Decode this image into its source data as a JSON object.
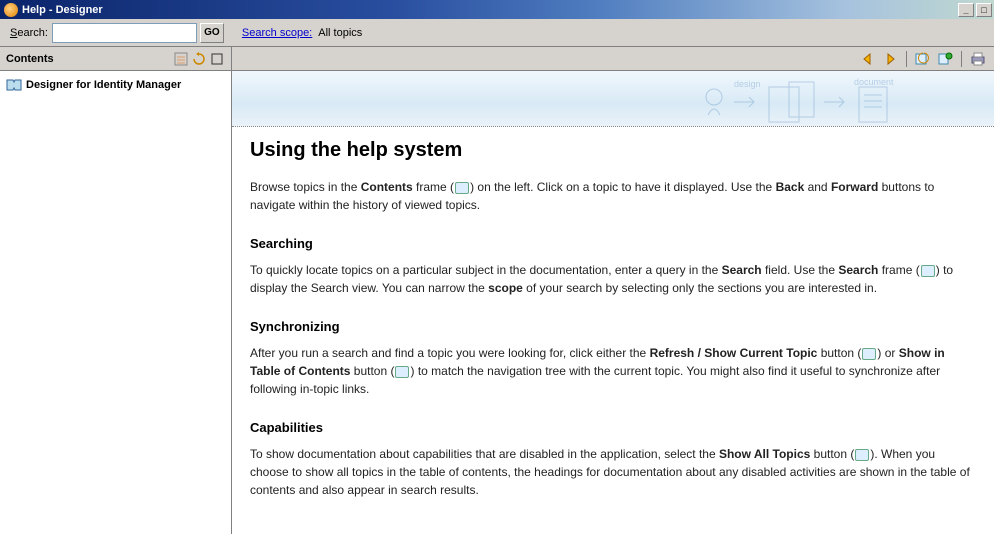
{
  "window": {
    "title": "Help - Designer",
    "min": "_",
    "max": "□"
  },
  "searchbar": {
    "label_underline": "S",
    "label_rest": "earch:",
    "go": "GO",
    "scope_label": "Search scope:",
    "scope_value": "All topics",
    "placeholder": ""
  },
  "contents": {
    "title": "Contents",
    "root": "Designer for Identity Manager"
  },
  "doc": {
    "title": "Using the help system",
    "p1a": "Browse topics in the ",
    "p1b": "Contents",
    "p1c": " frame (",
    "p1d": ") on the left. Click on a topic to have it displayed. Use the ",
    "p1e": "Back",
    "p1f": " and ",
    "p1g": "Forward",
    "p1h": " buttons to navigate within the history of viewed topics.",
    "h_search": "Searching",
    "p2a": "To quickly locate topics on a particular subject in the documentation, enter a query in the ",
    "p2b": "Search",
    "p2c": " field. Use the ",
    "p2d": "Search",
    "p2e": " frame (",
    "p2f": ") to display the Search view. You can narrow the ",
    "p2g": "scope",
    "p2h": " of your search by selecting only the sections you are interested in.",
    "h_sync": "Synchronizing",
    "p3a": "After you run a search and find a topic you were looking for, click either the ",
    "p3b": "Refresh / Show Current Topic",
    "p3c": " button (",
    "p3d": ") or ",
    "p3e": "Show in Table of Contents",
    "p3f": " button (",
    "p3g": ") to match the navigation tree with the current topic. You might also find it useful to synchronize after following in-topic links.",
    "h_cap": "Capabilities",
    "p4a": "To show documentation about capabilities that are disabled in the application, select the ",
    "p4b": "Show All Topics",
    "p4c": " button (",
    "p4d": "). When you choose to show all topics in the table of contents, the headings for documentation about any disabled activities are shown in the table of contents and also appear in search results."
  },
  "banner": {
    "label_design": "design",
    "label_document": "document"
  }
}
